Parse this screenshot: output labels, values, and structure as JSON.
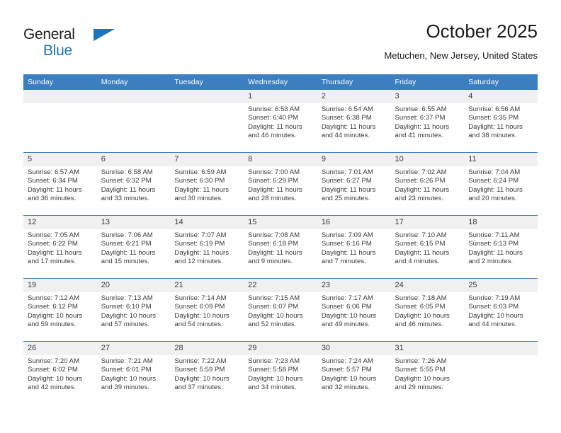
{
  "brand": {
    "name_top": "General",
    "name_bottom": "Blue",
    "triangle_icon": "triangle-logo-icon",
    "color_primary": "#1b75bb",
    "color_dark": "#231f20"
  },
  "header": {
    "title": "October 2025",
    "location": "Metuchen, New Jersey, United States"
  },
  "theme": {
    "header_row_bg": "#3c7fc1",
    "daynum_bg": "#f0f0f0",
    "grid_line": "#3c7fc1",
    "text": "#3a3a3a"
  },
  "weekday_headers": [
    "Sunday",
    "Monday",
    "Tuesday",
    "Wednesday",
    "Thursday",
    "Friday",
    "Saturday"
  ],
  "weeks": [
    [
      {
        "day": "",
        "empty": true,
        "sunrise": "",
        "sunset": "",
        "daylight_line1": "",
        "daylight_line2": ""
      },
      {
        "day": "",
        "empty": true,
        "sunrise": "",
        "sunset": "",
        "daylight_line1": "",
        "daylight_line2": ""
      },
      {
        "day": "",
        "empty": true,
        "sunrise": "",
        "sunset": "",
        "daylight_line1": "",
        "daylight_line2": ""
      },
      {
        "day": "1",
        "empty": false,
        "sunrise": "Sunrise: 6:53 AM",
        "sunset": "Sunset: 6:40 PM",
        "daylight_line1": "Daylight: 11 hours",
        "daylight_line2": "and 46 minutes."
      },
      {
        "day": "2",
        "empty": false,
        "sunrise": "Sunrise: 6:54 AM",
        "sunset": "Sunset: 6:38 PM",
        "daylight_line1": "Daylight: 11 hours",
        "daylight_line2": "and 44 minutes."
      },
      {
        "day": "3",
        "empty": false,
        "sunrise": "Sunrise: 6:55 AM",
        "sunset": "Sunset: 6:37 PM",
        "daylight_line1": "Daylight: 11 hours",
        "daylight_line2": "and 41 minutes."
      },
      {
        "day": "4",
        "empty": false,
        "sunrise": "Sunrise: 6:56 AM",
        "sunset": "Sunset: 6:35 PM",
        "daylight_line1": "Daylight: 11 hours",
        "daylight_line2": "and 38 minutes."
      }
    ],
    [
      {
        "day": "5",
        "empty": false,
        "sunrise": "Sunrise: 6:57 AM",
        "sunset": "Sunset: 6:34 PM",
        "daylight_line1": "Daylight: 11 hours",
        "daylight_line2": "and 36 minutes."
      },
      {
        "day": "6",
        "empty": false,
        "sunrise": "Sunrise: 6:58 AM",
        "sunset": "Sunset: 6:32 PM",
        "daylight_line1": "Daylight: 11 hours",
        "daylight_line2": "and 33 minutes."
      },
      {
        "day": "7",
        "empty": false,
        "sunrise": "Sunrise: 6:59 AM",
        "sunset": "Sunset: 6:30 PM",
        "daylight_line1": "Daylight: 11 hours",
        "daylight_line2": "and 30 minutes."
      },
      {
        "day": "8",
        "empty": false,
        "sunrise": "Sunrise: 7:00 AM",
        "sunset": "Sunset: 6:29 PM",
        "daylight_line1": "Daylight: 11 hours",
        "daylight_line2": "and 28 minutes."
      },
      {
        "day": "9",
        "empty": false,
        "sunrise": "Sunrise: 7:01 AM",
        "sunset": "Sunset: 6:27 PM",
        "daylight_line1": "Daylight: 11 hours",
        "daylight_line2": "and 25 minutes."
      },
      {
        "day": "10",
        "empty": false,
        "sunrise": "Sunrise: 7:02 AM",
        "sunset": "Sunset: 6:26 PM",
        "daylight_line1": "Daylight: 11 hours",
        "daylight_line2": "and 23 minutes."
      },
      {
        "day": "11",
        "empty": false,
        "sunrise": "Sunrise: 7:04 AM",
        "sunset": "Sunset: 6:24 PM",
        "daylight_line1": "Daylight: 11 hours",
        "daylight_line2": "and 20 minutes."
      }
    ],
    [
      {
        "day": "12",
        "empty": false,
        "sunrise": "Sunrise: 7:05 AM",
        "sunset": "Sunset: 6:22 PM",
        "daylight_line1": "Daylight: 11 hours",
        "daylight_line2": "and 17 minutes."
      },
      {
        "day": "13",
        "empty": false,
        "sunrise": "Sunrise: 7:06 AM",
        "sunset": "Sunset: 6:21 PM",
        "daylight_line1": "Daylight: 11 hours",
        "daylight_line2": "and 15 minutes."
      },
      {
        "day": "14",
        "empty": false,
        "sunrise": "Sunrise: 7:07 AM",
        "sunset": "Sunset: 6:19 PM",
        "daylight_line1": "Daylight: 11 hours",
        "daylight_line2": "and 12 minutes."
      },
      {
        "day": "15",
        "empty": false,
        "sunrise": "Sunrise: 7:08 AM",
        "sunset": "Sunset: 6:18 PM",
        "daylight_line1": "Daylight: 11 hours",
        "daylight_line2": "and 9 minutes."
      },
      {
        "day": "16",
        "empty": false,
        "sunrise": "Sunrise: 7:09 AM",
        "sunset": "Sunset: 6:16 PM",
        "daylight_line1": "Daylight: 11 hours",
        "daylight_line2": "and 7 minutes."
      },
      {
        "day": "17",
        "empty": false,
        "sunrise": "Sunrise: 7:10 AM",
        "sunset": "Sunset: 6:15 PM",
        "daylight_line1": "Daylight: 11 hours",
        "daylight_line2": "and 4 minutes."
      },
      {
        "day": "18",
        "empty": false,
        "sunrise": "Sunrise: 7:11 AM",
        "sunset": "Sunset: 6:13 PM",
        "daylight_line1": "Daylight: 11 hours",
        "daylight_line2": "and 2 minutes."
      }
    ],
    [
      {
        "day": "19",
        "empty": false,
        "sunrise": "Sunrise: 7:12 AM",
        "sunset": "Sunset: 6:12 PM",
        "daylight_line1": "Daylight: 10 hours",
        "daylight_line2": "and 59 minutes."
      },
      {
        "day": "20",
        "empty": false,
        "sunrise": "Sunrise: 7:13 AM",
        "sunset": "Sunset: 6:10 PM",
        "daylight_line1": "Daylight: 10 hours",
        "daylight_line2": "and 57 minutes."
      },
      {
        "day": "21",
        "empty": false,
        "sunrise": "Sunrise: 7:14 AM",
        "sunset": "Sunset: 6:09 PM",
        "daylight_line1": "Daylight: 10 hours",
        "daylight_line2": "and 54 minutes."
      },
      {
        "day": "22",
        "empty": false,
        "sunrise": "Sunrise: 7:15 AM",
        "sunset": "Sunset: 6:07 PM",
        "daylight_line1": "Daylight: 10 hours",
        "daylight_line2": "and 52 minutes."
      },
      {
        "day": "23",
        "empty": false,
        "sunrise": "Sunrise: 7:17 AM",
        "sunset": "Sunset: 6:06 PM",
        "daylight_line1": "Daylight: 10 hours",
        "daylight_line2": "and 49 minutes."
      },
      {
        "day": "24",
        "empty": false,
        "sunrise": "Sunrise: 7:18 AM",
        "sunset": "Sunset: 6:05 PM",
        "daylight_line1": "Daylight: 10 hours",
        "daylight_line2": "and 46 minutes."
      },
      {
        "day": "25",
        "empty": false,
        "sunrise": "Sunrise: 7:19 AM",
        "sunset": "Sunset: 6:03 PM",
        "daylight_line1": "Daylight: 10 hours",
        "daylight_line2": "and 44 minutes."
      }
    ],
    [
      {
        "day": "26",
        "empty": false,
        "sunrise": "Sunrise: 7:20 AM",
        "sunset": "Sunset: 6:02 PM",
        "daylight_line1": "Daylight: 10 hours",
        "daylight_line2": "and 42 minutes."
      },
      {
        "day": "27",
        "empty": false,
        "sunrise": "Sunrise: 7:21 AM",
        "sunset": "Sunset: 6:01 PM",
        "daylight_line1": "Daylight: 10 hours",
        "daylight_line2": "and 39 minutes."
      },
      {
        "day": "28",
        "empty": false,
        "sunrise": "Sunrise: 7:22 AM",
        "sunset": "Sunset: 5:59 PM",
        "daylight_line1": "Daylight: 10 hours",
        "daylight_line2": "and 37 minutes."
      },
      {
        "day": "29",
        "empty": false,
        "sunrise": "Sunrise: 7:23 AM",
        "sunset": "Sunset: 5:58 PM",
        "daylight_line1": "Daylight: 10 hours",
        "daylight_line2": "and 34 minutes."
      },
      {
        "day": "30",
        "empty": false,
        "sunrise": "Sunrise: 7:24 AM",
        "sunset": "Sunset: 5:57 PM",
        "daylight_line1": "Daylight: 10 hours",
        "daylight_line2": "and 32 minutes."
      },
      {
        "day": "31",
        "empty": false,
        "sunrise": "Sunrise: 7:26 AM",
        "sunset": "Sunset: 5:55 PM",
        "daylight_line1": "Daylight: 10 hours",
        "daylight_line2": "and 29 minutes."
      },
      {
        "day": "",
        "empty": true,
        "sunrise": "",
        "sunset": "",
        "daylight_line1": "",
        "daylight_line2": ""
      }
    ]
  ]
}
